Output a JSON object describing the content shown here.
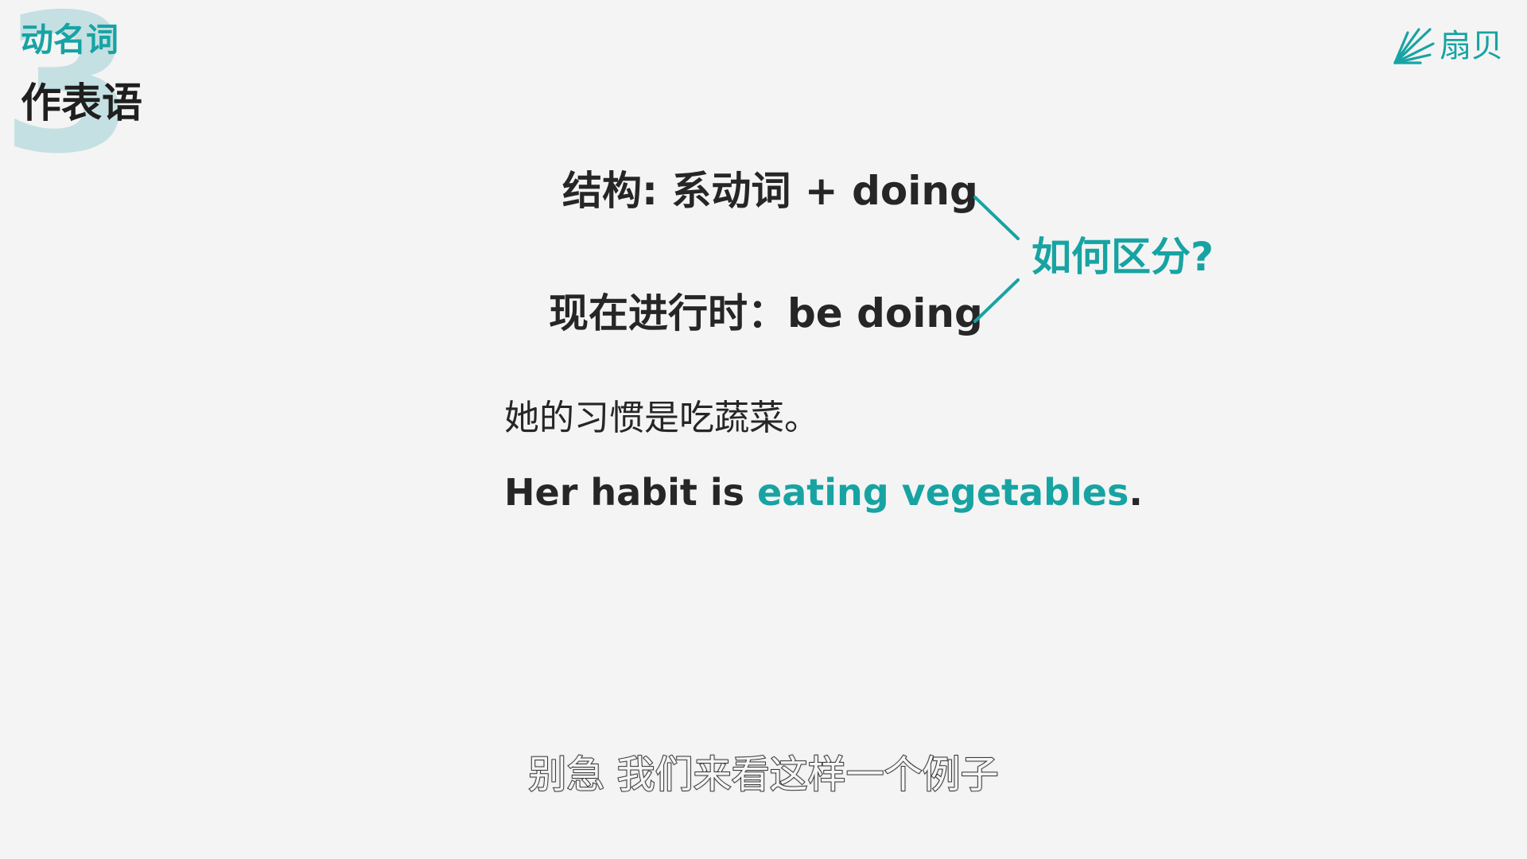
{
  "chapter": {
    "number": "3",
    "topic": "动名词",
    "subtopic": "作表语"
  },
  "brand": {
    "name": "扇贝",
    "icon": "shell-logo-icon"
  },
  "rules": {
    "gerund_structure": "结构: 系动词 + doing",
    "progressive_structure": "现在进行时：be doing",
    "question": "如何区分?"
  },
  "example": {
    "chinese": "她的习惯是吃蔬菜。",
    "english_prefix": "Her habit is ",
    "english_highlight": "eating vegetables",
    "english_suffix": "."
  },
  "subtitle": "别急 我们来看这样一个例子",
  "colors": {
    "accent": "#18a3a3",
    "text": "#262626",
    "background": "#f4f4f4",
    "badge": "#c4e0e2"
  }
}
